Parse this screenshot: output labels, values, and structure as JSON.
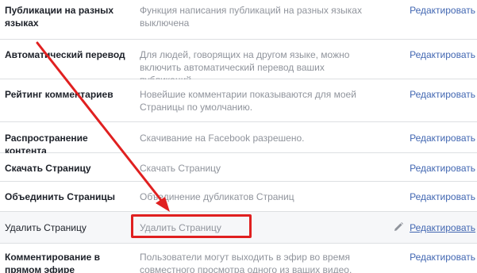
{
  "rows": [
    {
      "label": "Публикации на разных языках",
      "desc": "Функция написания публикаций на разных языках выключена",
      "edit": "Редактировать"
    },
    {
      "label": "Автоматический перевод",
      "desc": "Для людей, говорящих на другом языке, можно включить автоматический перевод ваших публикаций",
      "edit": "Редактировать"
    },
    {
      "label": "Рейтинг комментариев",
      "desc": "Новейшие комментарии показываются для моей Страницы по умолчанию.",
      "edit": "Редактировать"
    },
    {
      "label": "Распространение контента",
      "desc": "Скачивание на Facebook разрешено.",
      "edit": "Редактировать"
    },
    {
      "label": "Скачать Страницу",
      "desc": "Скачать Страницу",
      "edit": "Редактировать"
    },
    {
      "label": "Объединить Страницы",
      "desc": "Объединение дубликатов Страниц",
      "edit": "Редактировать"
    },
    {
      "label": "Удалить Страницу",
      "desc": "Удалить Страницу",
      "edit": "Редактировать"
    },
    {
      "label": "Комментирование в прямом эфире",
      "desc": "Пользователи могут выходить в эфир во время совместного просмотра одного из ваших видео.",
      "edit": "Редактировать"
    }
  ],
  "annotation_color": "#e02020",
  "link_color": "#4267b2",
  "icons": {
    "edit": "pencil-icon"
  }
}
